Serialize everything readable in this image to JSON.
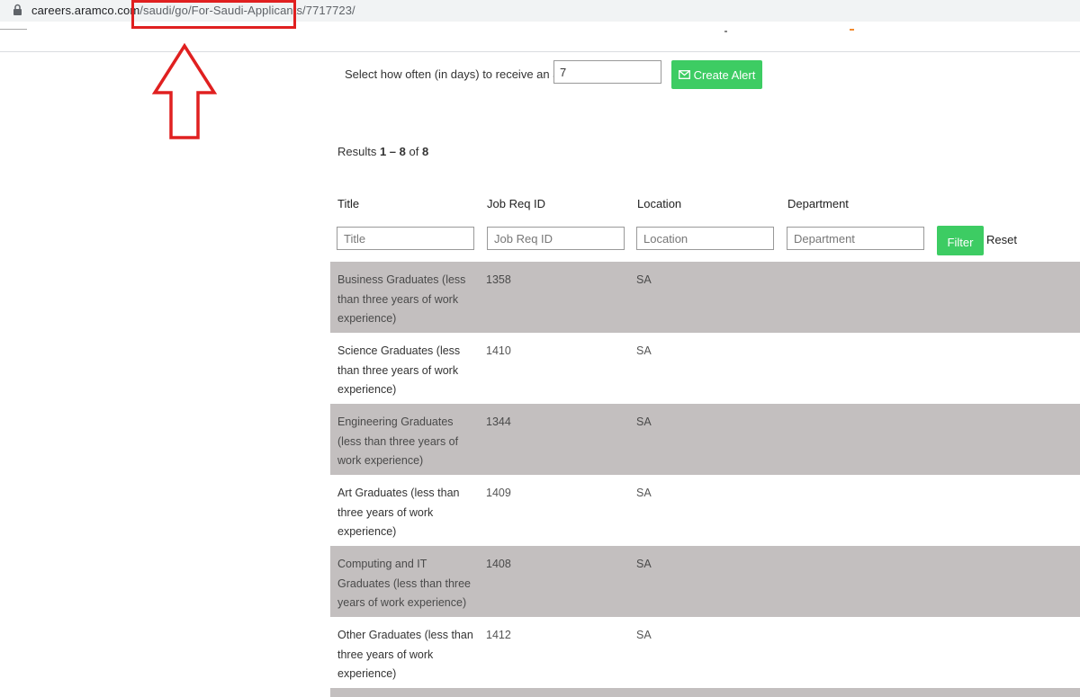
{
  "browser": {
    "url_domain": "careers.aramco.com",
    "url_path": "/saudi/go/For-Saudi-Applicants/7717723/"
  },
  "alert": {
    "label": "Select how often (in days) to receive an alert:",
    "value": "7",
    "button_label": "Create Alert"
  },
  "results": {
    "prefix": "Results ",
    "range": "1 – 8",
    "of": " of ",
    "total": "8"
  },
  "table": {
    "headers": [
      "Title",
      "Job Req ID",
      "Location",
      "Department"
    ],
    "filters": {
      "title_placeholder": "Title",
      "req_placeholder": "Job Req ID",
      "location_placeholder": "Location",
      "department_placeholder": "Department"
    },
    "filter_label": "Filter",
    "reset_label": "Reset",
    "rows": [
      {
        "title": "Business Graduates (less than three years of work experience)",
        "req_id": "1358",
        "location": "SA"
      },
      {
        "title": "Science Graduates (less than three years of work experience)",
        "req_id": "1410",
        "location": "SA"
      },
      {
        "title": "Engineering Graduates (less than three years of work experience)",
        "req_id": "1344",
        "location": "SA"
      },
      {
        "title": "Art Graduates (less than three years of work experience)",
        "req_id": "1409",
        "location": "SA"
      },
      {
        "title": "Computing and IT Graduates (less than three years of work experience)",
        "req_id": "1408",
        "location": "SA"
      },
      {
        "title": "Other Graduates (less than three years of work experience)",
        "req_id": "1412",
        "location": "SA"
      }
    ]
  },
  "colors": {
    "accent_green": "#3dcc63",
    "row_shade": "#c3bfbf",
    "annotation_red": "#e02020"
  }
}
